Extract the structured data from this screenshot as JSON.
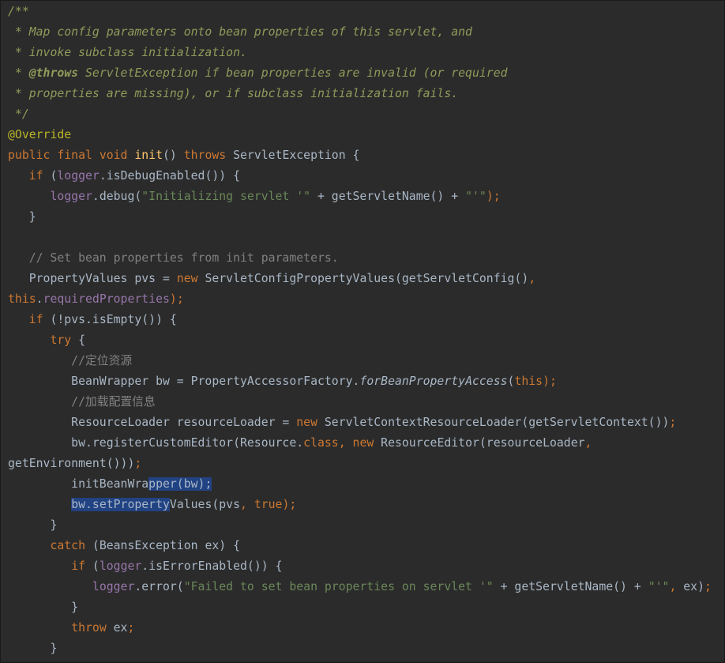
{
  "editor": {
    "language": "java",
    "theme_colors": {
      "background": "#2b2b2b",
      "text": "#a9b7c6",
      "keyword": "#cc7832",
      "method": "#ffc66d",
      "field": "#9876aa",
      "string": "#6a8759",
      "comment": "#808080",
      "doc_comment": "#8f9b5a",
      "annotation": "#bbb529",
      "selection": "#214283"
    },
    "lines": [
      [
        {
          "t": "/**",
          "c": "doc"
        }
      ],
      [
        {
          "t": " * Map config parameters onto bean properties of this servlet, and",
          "c": "doc"
        }
      ],
      [
        {
          "t": " * invoke subclass initialization.",
          "c": "doc"
        }
      ],
      [
        {
          "t": " * ",
          "c": "doc"
        },
        {
          "t": "@throws",
          "c": "doctag"
        },
        {
          "t": " ServletException if bean properties are invalid (or required",
          "c": "doc"
        }
      ],
      [
        {
          "t": " * properties are missing), or if subclass initialization fails.",
          "c": "doc"
        }
      ],
      [
        {
          "t": " */",
          "c": "doc"
        }
      ],
      [
        {
          "t": "@Override",
          "c": "annotation"
        }
      ],
      [
        {
          "t": "public ",
          "c": "keyword"
        },
        {
          "t": "final ",
          "c": "keyword"
        },
        {
          "t": "void ",
          "c": "keyword"
        },
        {
          "t": "init",
          "c": "method"
        },
        {
          "t": "() ",
          "c": "plain"
        },
        {
          "t": "throws ",
          "c": "keyword"
        },
        {
          "t": "ServletException {",
          "c": "plain"
        }
      ],
      [
        {
          "t": "   ",
          "c": "plain"
        },
        {
          "t": "if ",
          "c": "keyword"
        },
        {
          "t": "(",
          "c": "plain"
        },
        {
          "t": "logger",
          "c": "field"
        },
        {
          "t": ".isDebugEnabled()) {",
          "c": "plain"
        }
      ],
      [
        {
          "t": "      ",
          "c": "plain"
        },
        {
          "t": "logger",
          "c": "field"
        },
        {
          "t": ".debug(",
          "c": "plain"
        },
        {
          "t": "\"Initializing servlet '\"",
          "c": "string"
        },
        {
          "t": " + getServletName() + ",
          "c": "plain"
        },
        {
          "t": "\"'\"",
          "c": "string"
        },
        {
          "t": ");",
          "c": "punct"
        }
      ],
      [
        {
          "t": "   }",
          "c": "plain"
        }
      ],
      [
        {
          "t": "",
          "c": "plain"
        }
      ],
      [
        {
          "t": "   // Set bean properties from init parameters.",
          "c": "linecomment"
        }
      ],
      [
        {
          "t": "   PropertyValues pvs = ",
          "c": "plain"
        },
        {
          "t": "new ",
          "c": "keyword"
        },
        {
          "t": "ServletConfigPropertyValues(getServletConfig()",
          "c": "plain"
        },
        {
          "t": ",",
          "c": "punct"
        }
      ],
      [
        {
          "t": "this",
          "c": "keyword"
        },
        {
          "t": ".",
          "c": "plain"
        },
        {
          "t": "requiredProperties",
          "c": "field"
        },
        {
          "t": ");",
          "c": "punct"
        }
      ],
      [
        {
          "t": "   ",
          "c": "plain"
        },
        {
          "t": "if ",
          "c": "keyword"
        },
        {
          "t": "(!pvs.isEmpty()) {",
          "c": "plain"
        }
      ],
      [
        {
          "t": "      ",
          "c": "plain"
        },
        {
          "t": "try ",
          "c": "keyword"
        },
        {
          "t": "{",
          "c": "plain"
        }
      ],
      [
        {
          "t": "         //定位资源",
          "c": "linecomment"
        }
      ],
      [
        {
          "t": "         BeanWrapper bw = PropertyAccessorFactory.",
          "c": "plain"
        },
        {
          "t": "forBeanPropertyAccess",
          "c": "staticcall"
        },
        {
          "t": "(",
          "c": "plain"
        },
        {
          "t": "this",
          "c": "keyword"
        },
        {
          "t": ");",
          "c": "punct"
        }
      ],
      [
        {
          "t": "         //加载配置信息",
          "c": "linecomment"
        }
      ],
      [
        {
          "t": "         ResourceLoader resourceLoader = ",
          "c": "plain"
        },
        {
          "t": "new ",
          "c": "keyword"
        },
        {
          "t": "ServletContextResourceLoader(getServletContext())",
          "c": "plain"
        },
        {
          "t": ";",
          "c": "punct"
        }
      ],
      [
        {
          "t": "         bw.registerCustomEditor(Resource.",
          "c": "plain"
        },
        {
          "t": "class",
          "c": "keyword"
        },
        {
          "t": ", ",
          "c": "punct"
        },
        {
          "t": "new ",
          "c": "keyword"
        },
        {
          "t": "ResourceEditor(resourceLoader",
          "c": "plain"
        },
        {
          "t": ",",
          "c": "punct"
        }
      ],
      [
        {
          "t": "getEnvironment()))",
          "c": "plain"
        },
        {
          "t": ";",
          "c": "punct"
        }
      ],
      [
        {
          "t": "         initBeanWra",
          "c": "plain"
        },
        {
          "t": "pper(bw);",
          "c": "plain",
          "sel": true
        }
      ],
      [
        {
          "t": "         ",
          "c": "plain"
        },
        {
          "t": "bw.setProperty",
          "c": "plain",
          "sel": true
        },
        {
          "t": "Values(pvs",
          "c": "plain"
        },
        {
          "t": ", ",
          "c": "punct"
        },
        {
          "t": "true",
          "c": "keyword"
        },
        {
          "t": ");",
          "c": "punct"
        }
      ],
      [
        {
          "t": "      }",
          "c": "plain"
        }
      ],
      [
        {
          "t": "      ",
          "c": "plain"
        },
        {
          "t": "catch ",
          "c": "keyword"
        },
        {
          "t": "(BeansException ex) {",
          "c": "plain"
        }
      ],
      [
        {
          "t": "         ",
          "c": "plain"
        },
        {
          "t": "if ",
          "c": "keyword"
        },
        {
          "t": "(",
          "c": "plain"
        },
        {
          "t": "logger",
          "c": "field"
        },
        {
          "t": ".isErrorEnabled()) {",
          "c": "plain"
        }
      ],
      [
        {
          "t": "            ",
          "c": "plain"
        },
        {
          "t": "logger",
          "c": "field"
        },
        {
          "t": ".error(",
          "c": "plain"
        },
        {
          "t": "\"Failed to set bean properties on servlet '\"",
          "c": "string"
        },
        {
          "t": " + getServletName() + ",
          "c": "plain"
        },
        {
          "t": "\"'\"",
          "c": "string"
        },
        {
          "t": ", ",
          "c": "punct"
        },
        {
          "t": "ex)",
          "c": "plain"
        },
        {
          "t": ";",
          "c": "punct"
        }
      ],
      [
        {
          "t": "         }",
          "c": "plain"
        }
      ],
      [
        {
          "t": "         ",
          "c": "plain"
        },
        {
          "t": "throw ",
          "c": "keyword"
        },
        {
          "t": "ex",
          "c": "plain"
        },
        {
          "t": ";",
          "c": "punct"
        }
      ],
      [
        {
          "t": "      }",
          "c": "plain"
        }
      ]
    ]
  }
}
